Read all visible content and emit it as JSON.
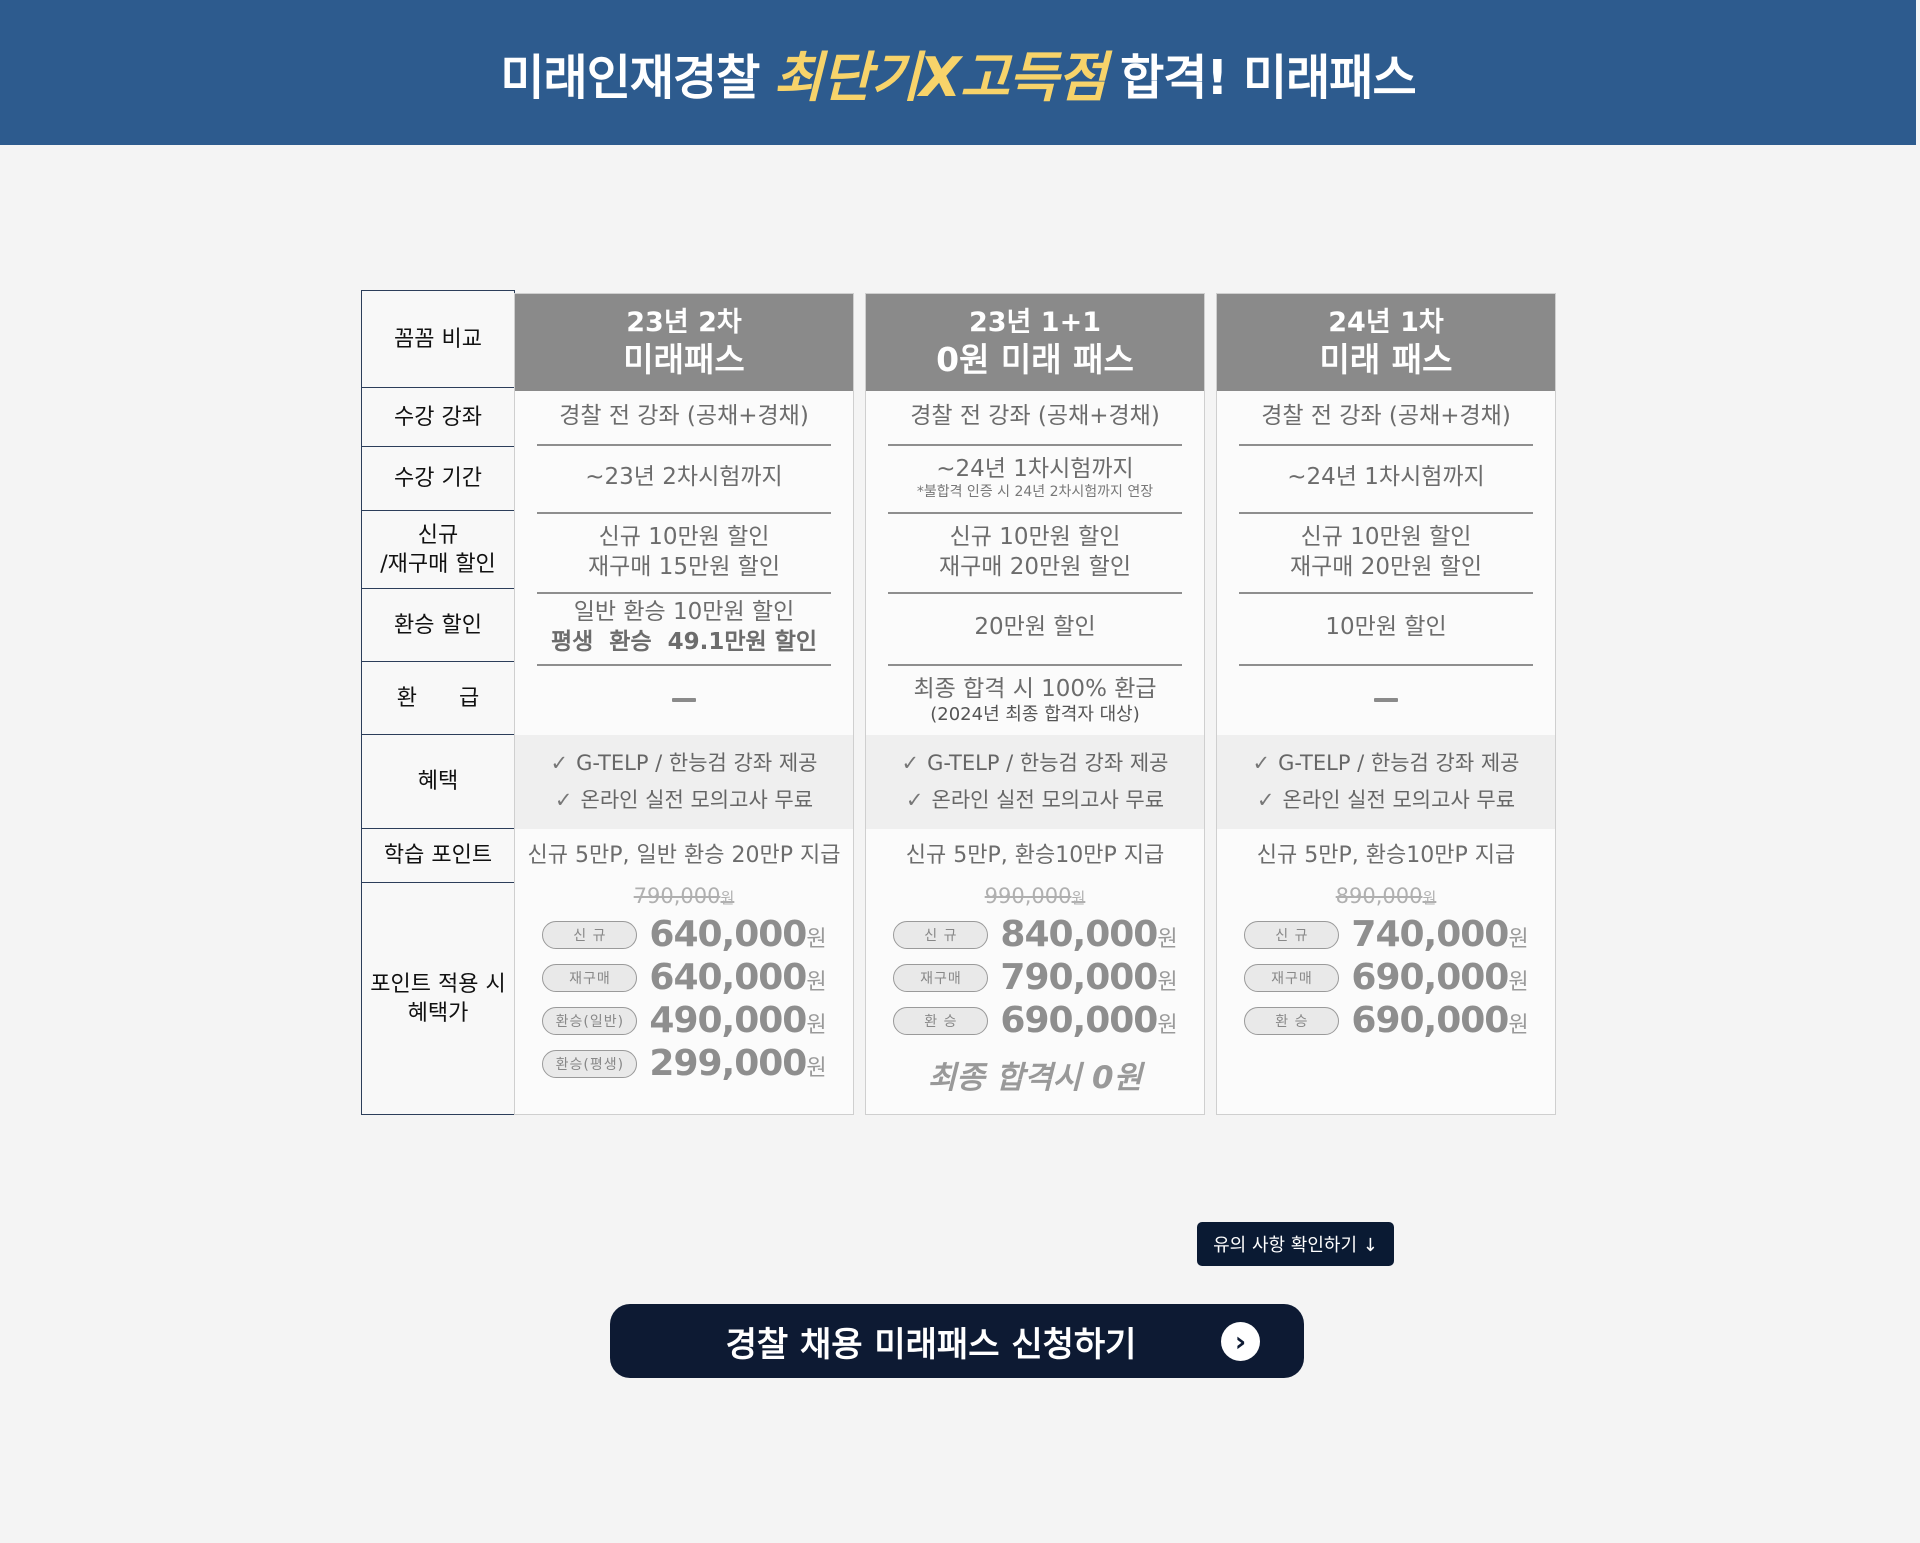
{
  "banner": {
    "title_part1": "미래인재경찰",
    "title_highlight": "최단기X고득점",
    "title_part2": "합격! 미래패스",
    "bg_color": "#2d5b8e",
    "highlight_color": "#f7d36a"
  },
  "side_labels": {
    "compare": "꼼꼼 비교",
    "courses": "수강 강좌",
    "period": "수강 기간",
    "discount_line1": "신규",
    "discount_line2": "/재구매 할인",
    "transfer": "환승 할인",
    "refund": "환      급",
    "benefits": "혜택",
    "points": "학습 포인트",
    "price_line1": "포인트 적용 시",
    "price_line2": "혜택가"
  },
  "plans": [
    {
      "head1": "23년 2차",
      "head2": "미래패스",
      "courses": "경찰 전 강좌 (공채+경채)",
      "period": "~23년 2차시험까지",
      "period_note": "",
      "discount1": "신규 10만원 할인",
      "discount2": "재구매 15만원 할인",
      "transfer1": "일반 환승 10만원 할인",
      "transfer2": "평생  환승  49.1만원 할인",
      "refund1": "",
      "refund2": "",
      "benefit1": "G-TELP / 한능검 강좌 제공",
      "benefit2": "온라인 실전 모의고사 무료",
      "points": "신규 5만P, 일반 환승 20만P 지급",
      "original_price": "790,000",
      "original_won": "원",
      "prices": [
        {
          "tag": "신 규",
          "amount": "640,000",
          "won": "원"
        },
        {
          "tag": "재구매",
          "amount": "640,000",
          "won": "원"
        },
        {
          "tag": "환승(일반)",
          "amount": "490,000",
          "won": "원"
        },
        {
          "tag": "환승(평생)",
          "amount": "299,000",
          "won": "원"
        }
      ],
      "final_note": ""
    },
    {
      "head1": "23년 1+1",
      "head2": "0원 미래 패스",
      "courses": "경찰 전 강좌 (공채+경채)",
      "period": "~24년 1차시험까지",
      "period_note": "*불합격 인증 시 24년 2차시험까지 연장",
      "discount1": "신규 10만원 할인",
      "discount2": "재구매 20만원 할인",
      "transfer1": "20만원 할인",
      "transfer2": "",
      "refund1": "최종 합격 시 100% 환급",
      "refund2": "(2024년 최종 합격자 대상)",
      "benefit1": "G-TELP / 한능검 강좌 제공",
      "benefit2": "온라인 실전 모의고사 무료",
      "points": "신규 5만P, 환승10만P 지급",
      "original_price": "990,000",
      "original_won": "원",
      "prices": [
        {
          "tag": "신 규",
          "amount": "840,000",
          "won": "원"
        },
        {
          "tag": "재구매",
          "amount": "790,000",
          "won": "원"
        },
        {
          "tag": "환 승",
          "amount": "690,000",
          "won": "원"
        }
      ],
      "final_note": "최종 합격시 0원"
    },
    {
      "head1": "24년 1차",
      "head2": "미래 패스",
      "courses": "경찰 전 강좌 (공채+경채)",
      "period": "~24년 1차시험까지",
      "period_note": "",
      "discount1": "신규 10만원 할인",
      "discount2": "재구매 20만원 할인",
      "transfer1": "10만원 할인",
      "transfer2": "",
      "refund1": "",
      "refund2": "",
      "benefit1": "G-TELP / 한능검 강좌 제공",
      "benefit2": "온라인 실전 모의고사 무료",
      "points": "신규 5만P, 환승10만P 지급",
      "original_price": "890,000",
      "original_won": "원",
      "prices": [
        {
          "tag": "신 규",
          "amount": "740,000",
          "won": "원"
        },
        {
          "tag": "재구매",
          "amount": "690,000",
          "won": "원"
        },
        {
          "tag": "환 승",
          "amount": "690,000",
          "won": "원"
        }
      ],
      "final_note": ""
    }
  ],
  "notice_button": "유의 사항 확인하기 ↓",
  "apply_button": "경찰 채용 미래패스 신청하기",
  "apply_arrow": "›"
}
